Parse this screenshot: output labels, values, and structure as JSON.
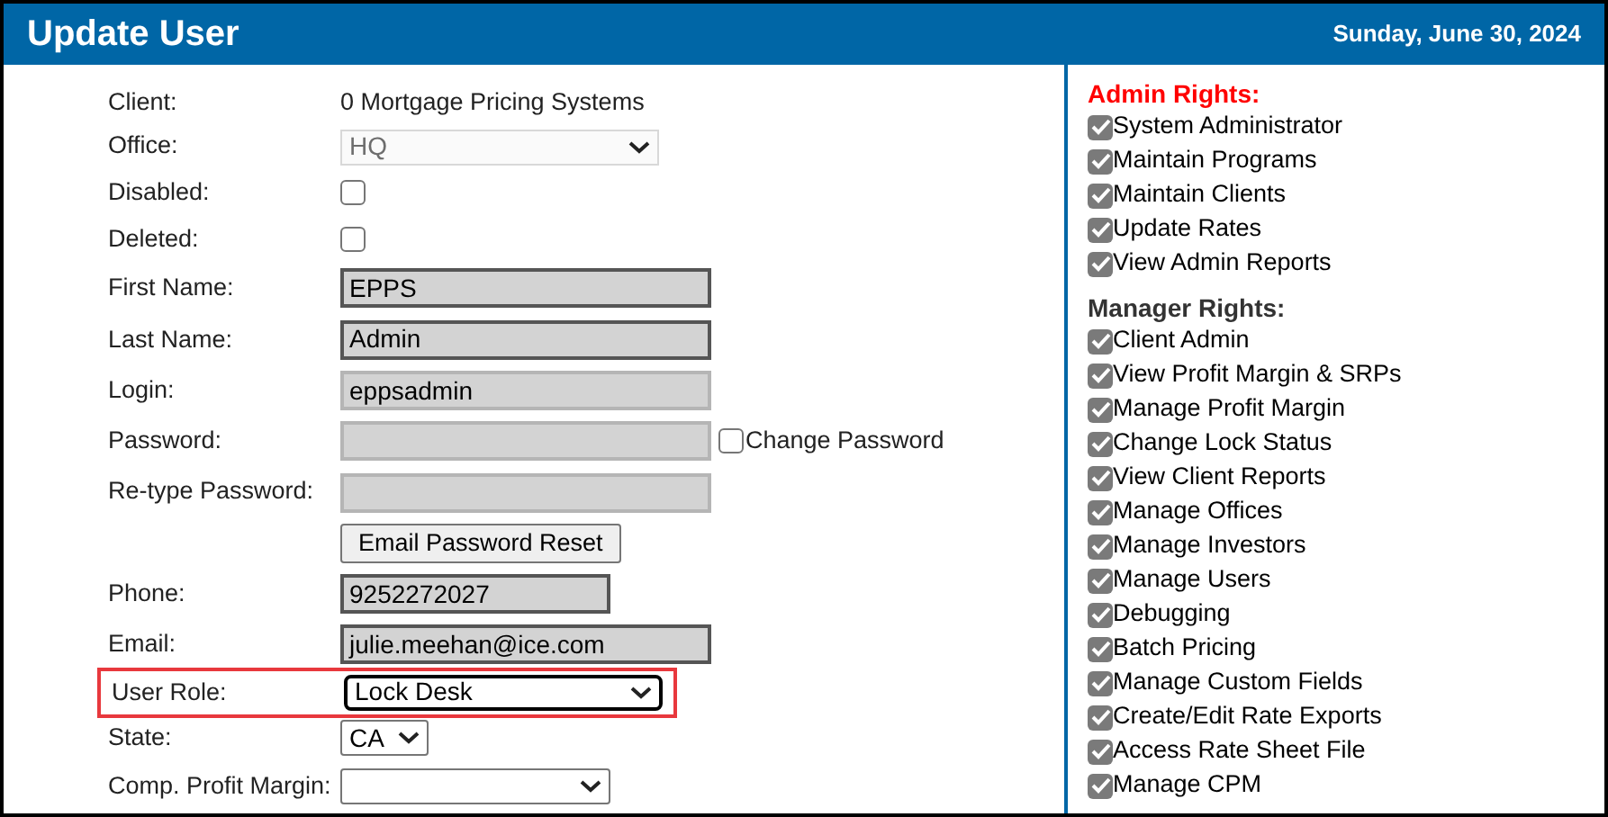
{
  "header": {
    "title": "Update User",
    "date": "Sunday, June 30, 2024"
  },
  "form": {
    "rows": [
      {
        "kind": "text",
        "label": "Client:",
        "value": "0 Mortgage Pricing Systems"
      },
      {
        "kind": "select",
        "label": "Office:",
        "value": "HQ",
        "disabled": true
      },
      {
        "kind": "checkbox",
        "label": "Disabled:",
        "checked": false
      },
      {
        "kind": "checkbox",
        "label": "Deleted:",
        "checked": false
      },
      {
        "kind": "field",
        "label": "First Name:",
        "value": "EPPS",
        "disabled": false
      },
      {
        "kind": "field",
        "label": "Last Name:",
        "value": "Admin",
        "disabled": false
      },
      {
        "kind": "field",
        "label": "Login:",
        "value": "eppsadmin",
        "disabled": true
      },
      {
        "kind": "field",
        "label": "Password:",
        "value": "",
        "disabled": true,
        "extra": {
          "label": "Change Password",
          "checked": false
        }
      },
      {
        "kind": "field",
        "label": "Re-type Password:",
        "value": "",
        "disabled": true
      },
      {
        "kind": "button",
        "label": "Email Password Reset"
      },
      {
        "kind": "short-field",
        "label": "Phone:",
        "value": "9252272027",
        "disabled": false
      },
      {
        "kind": "field",
        "label": "Email:",
        "value": "julie.meehan@ice.com",
        "disabled": false
      },
      {
        "kind": "select",
        "label": "User Role:",
        "value": "Lock Desk",
        "disabled": false,
        "highlighted": true
      },
      {
        "kind": "small-select",
        "label": "State:",
        "value": "CA",
        "disabled": false
      },
      {
        "kind": "short-select",
        "label": "Comp. Profit Margin:",
        "disabled": false
      }
    ]
  },
  "rights": [
    {
      "title": "Admin Rights:",
      "color": "#ff0000",
      "items": [
        {
          "label": "System Administrator",
          "checked": true
        },
        {
          "label": "Maintain Programs",
          "checked": true
        },
        {
          "label": "Maintain Clients",
          "checked": true
        },
        {
          "label": "Update Rates",
          "checked": true
        },
        {
          "label": "View Admin Reports",
          "checked": true
        }
      ]
    },
    {
      "title": "Manager Rights:",
      "color": "#333333",
      "items": [
        {
          "label": "Client Admin",
          "checked": true
        },
        {
          "label": "View Profit Margin & SRPs",
          "checked": true
        },
        {
          "label": "Manage Profit Margin",
          "checked": true
        },
        {
          "label": "Change Lock Status",
          "checked": true
        },
        {
          "label": "View Client Reports",
          "checked": true
        },
        {
          "label": "Manage Offices",
          "checked": true
        },
        {
          "label": "Manage Investors",
          "checked": true
        },
        {
          "label": "Manage Users",
          "checked": true
        },
        {
          "label": "Debugging",
          "checked": true
        },
        {
          "label": "Batch Pricing",
          "checked": true
        },
        {
          "label": "Manage Custom Fields",
          "checked": true
        },
        {
          "label": "Create/Edit Rate Exports",
          "checked": true
        },
        {
          "label": "Access Rate Sheet File",
          "checked": true
        },
        {
          "label": "Manage CPM",
          "checked": true
        }
      ]
    }
  ]
}
